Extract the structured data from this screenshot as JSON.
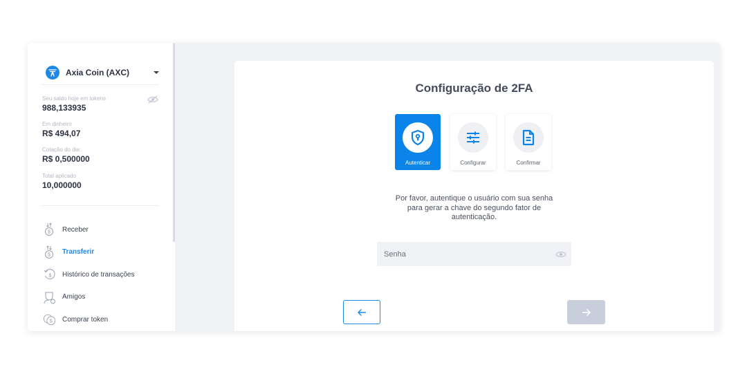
{
  "sidebar": {
    "coin": {
      "name": "Axia Coin (AXC)",
      "icon": "axia-logo-icon"
    },
    "stats": [
      {
        "label": "Seu saldo hoje em tokens",
        "value": "988,133935"
      },
      {
        "label": "Em dinheiro",
        "value": "R$ 494,07"
      },
      {
        "label": "Cotação do dia:",
        "value": "R$ 0,500000"
      },
      {
        "label": "Total aplicado",
        "value": "10,000000"
      }
    ],
    "menu": [
      {
        "label": "Receber",
        "icon": "receive-money-icon",
        "active": false
      },
      {
        "label": "Transferir",
        "icon": "transfer-money-icon",
        "active": true
      },
      {
        "label": "Histórico de transações",
        "icon": "history-icon",
        "active": false
      },
      {
        "label": "Amigos",
        "icon": "friends-icon",
        "active": false
      },
      {
        "label": "Comprar token",
        "icon": "buy-token-icon",
        "active": false
      }
    ]
  },
  "main": {
    "title": "Configuração de 2FA",
    "steps": [
      {
        "label": "Autenticar",
        "icon": "shield-key-icon",
        "active": true
      },
      {
        "label": "Configurar",
        "icon": "sliders-icon",
        "active": false
      },
      {
        "label": "Confirmar",
        "icon": "document-icon",
        "active": false
      }
    ],
    "instructions": [
      "Por favor, autentique o usuário com sua senha",
      "para gerar a chave do segundo fator de",
      "autenticação."
    ],
    "password": {
      "placeholder": "Senha",
      "value": ""
    },
    "back_icon": "arrow-left-icon",
    "next_icon": "arrow-right-icon"
  },
  "colors": {
    "accent": "#1e88e5",
    "step_active": "#0a84e8",
    "disabled_button": "#c9cedc",
    "background": "#f1f2f5"
  }
}
